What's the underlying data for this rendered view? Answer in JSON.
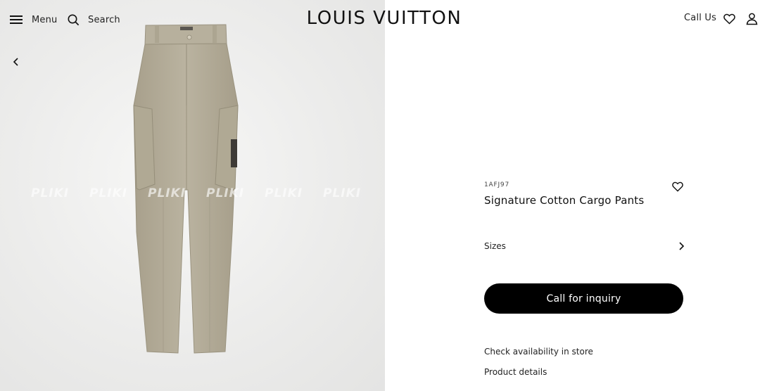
{
  "header": {
    "menu_label": "Menu",
    "search_label": "Search",
    "brand_logo": "LOUIS VUITTON",
    "call_us_label": "Call Us",
    "icons": {
      "menu": "hamburger-icon",
      "search": "search-icon",
      "wishlist": "heart-icon",
      "account": "user-icon"
    }
  },
  "gallery": {
    "prev_icon": "chevron-left-icon",
    "product_image_alt": "beige cargo pants",
    "watermarks": [
      "PLIKI",
      "PLIKI",
      "PLIKI",
      "PLIKI",
      "PLIKI",
      "PLIKI"
    ]
  },
  "product": {
    "sku": "1AFJ97",
    "name": "Signature Cotton Cargo Pants",
    "wishlist_icon": "heart-icon",
    "sizes_label": "Sizes",
    "sizes_icon": "chevron-right-icon",
    "cta_label": "Call for inquiry",
    "availability_link": "Check availability in store",
    "details_link": "Product details"
  },
  "colors": {
    "cta_background": "#000000",
    "cta_text": "#ffffff",
    "pants_fabric": "#b5ae9b",
    "gallery_background": "#ececeb"
  }
}
